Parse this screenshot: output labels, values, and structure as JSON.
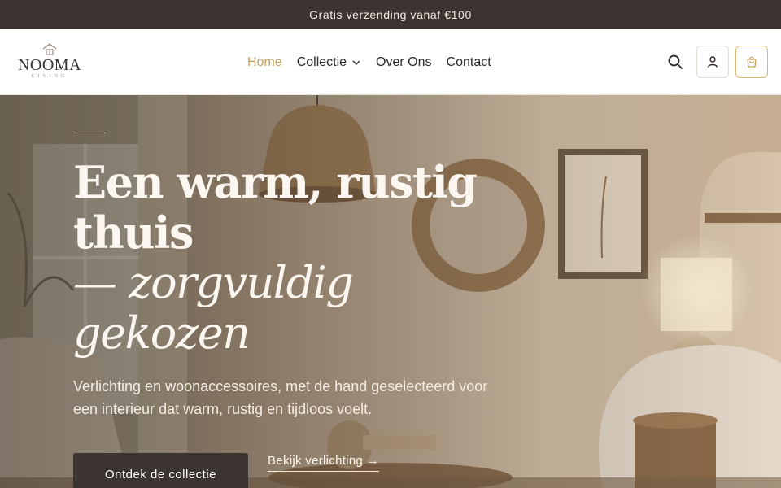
{
  "announcement": {
    "text": "Gratis verzending vanaf €100"
  },
  "brand": {
    "name": "NOOMA",
    "tagline": "LIVING"
  },
  "nav": {
    "items": [
      {
        "label": "Home",
        "active": true
      },
      {
        "label": "Collectie",
        "has_dropdown": true
      },
      {
        "label": "Over Ons"
      },
      {
        "label": "Contact"
      }
    ]
  },
  "header_actions": {
    "search_icon": "search-icon",
    "account_icon": "user-icon",
    "cart_icon": "shopping-bag-icon"
  },
  "hero": {
    "title": "Een warm, rustig thuis",
    "title_emphasis": "— zorgvuldig gekozen",
    "text": "Verlichting en woonaccessoires, met de hand geselecteerd voor een interieur dat warm, rustig en tijdloos voelt.",
    "primary_cta": "Ontdek de collectie",
    "secondary_cta": "Bekijk verlichting →"
  },
  "colors": {
    "announcement_bg": "#3c3431",
    "accent": "#c9a35c",
    "text_dark": "#2e2926",
    "hero_text": "#fbf6ef",
    "primary_button_bg": "#3c3431"
  }
}
